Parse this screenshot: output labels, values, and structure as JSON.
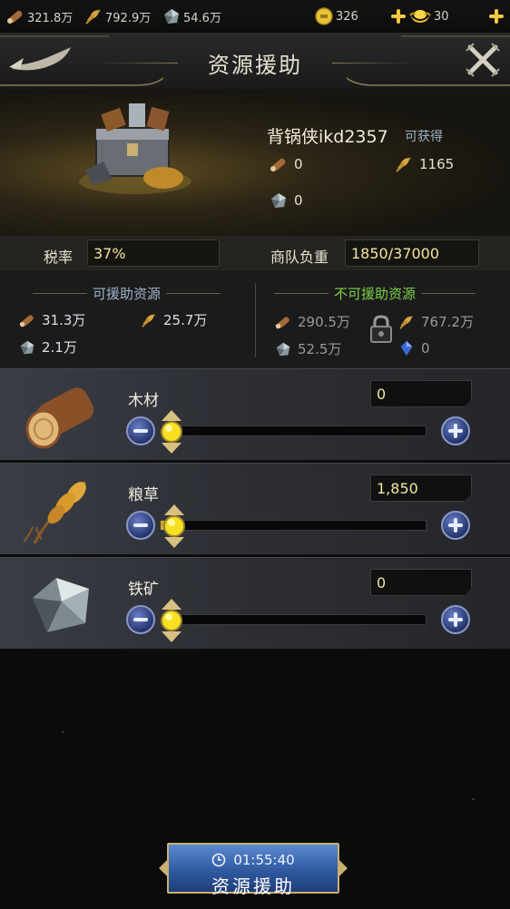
{
  "topbar": {
    "wood": "321.8万",
    "grain": "792.9万",
    "iron": "54.6万",
    "coins": "326",
    "gold": "30"
  },
  "header": {
    "title": "资源援助"
  },
  "hero": {
    "player_name": "背锅侠ikd2357",
    "gain_label": "可获得",
    "wood": "0",
    "grain": "1165",
    "iron": "0"
  },
  "stats": {
    "tax_label": "税率",
    "tax_value": "37%",
    "load_label": "商队负重",
    "load_value": "1850/37000"
  },
  "available": {
    "title": "可援助资源",
    "wood": "31.3万",
    "grain": "25.7万",
    "iron": "2.1万"
  },
  "unavailable": {
    "title": "不可援助资源",
    "wood": "290.5万",
    "grain": "767.2万",
    "iron": "52.5万",
    "gem": "0"
  },
  "rows": [
    {
      "label": "木材",
      "value": "0",
      "fraction": 0
    },
    {
      "label": "粮草",
      "value": "1,850",
      "fraction": 0.05
    },
    {
      "label": "铁矿",
      "value": "0",
      "fraction": 0
    }
  ],
  "button": {
    "timer": "01:55:40",
    "label": "资源援助"
  },
  "colors": {
    "accent_gold": "#f5c842",
    "value_yellow": "#f3e6a0",
    "available_green": "#7ed04a",
    "button_blue": "#2f5aa0"
  }
}
